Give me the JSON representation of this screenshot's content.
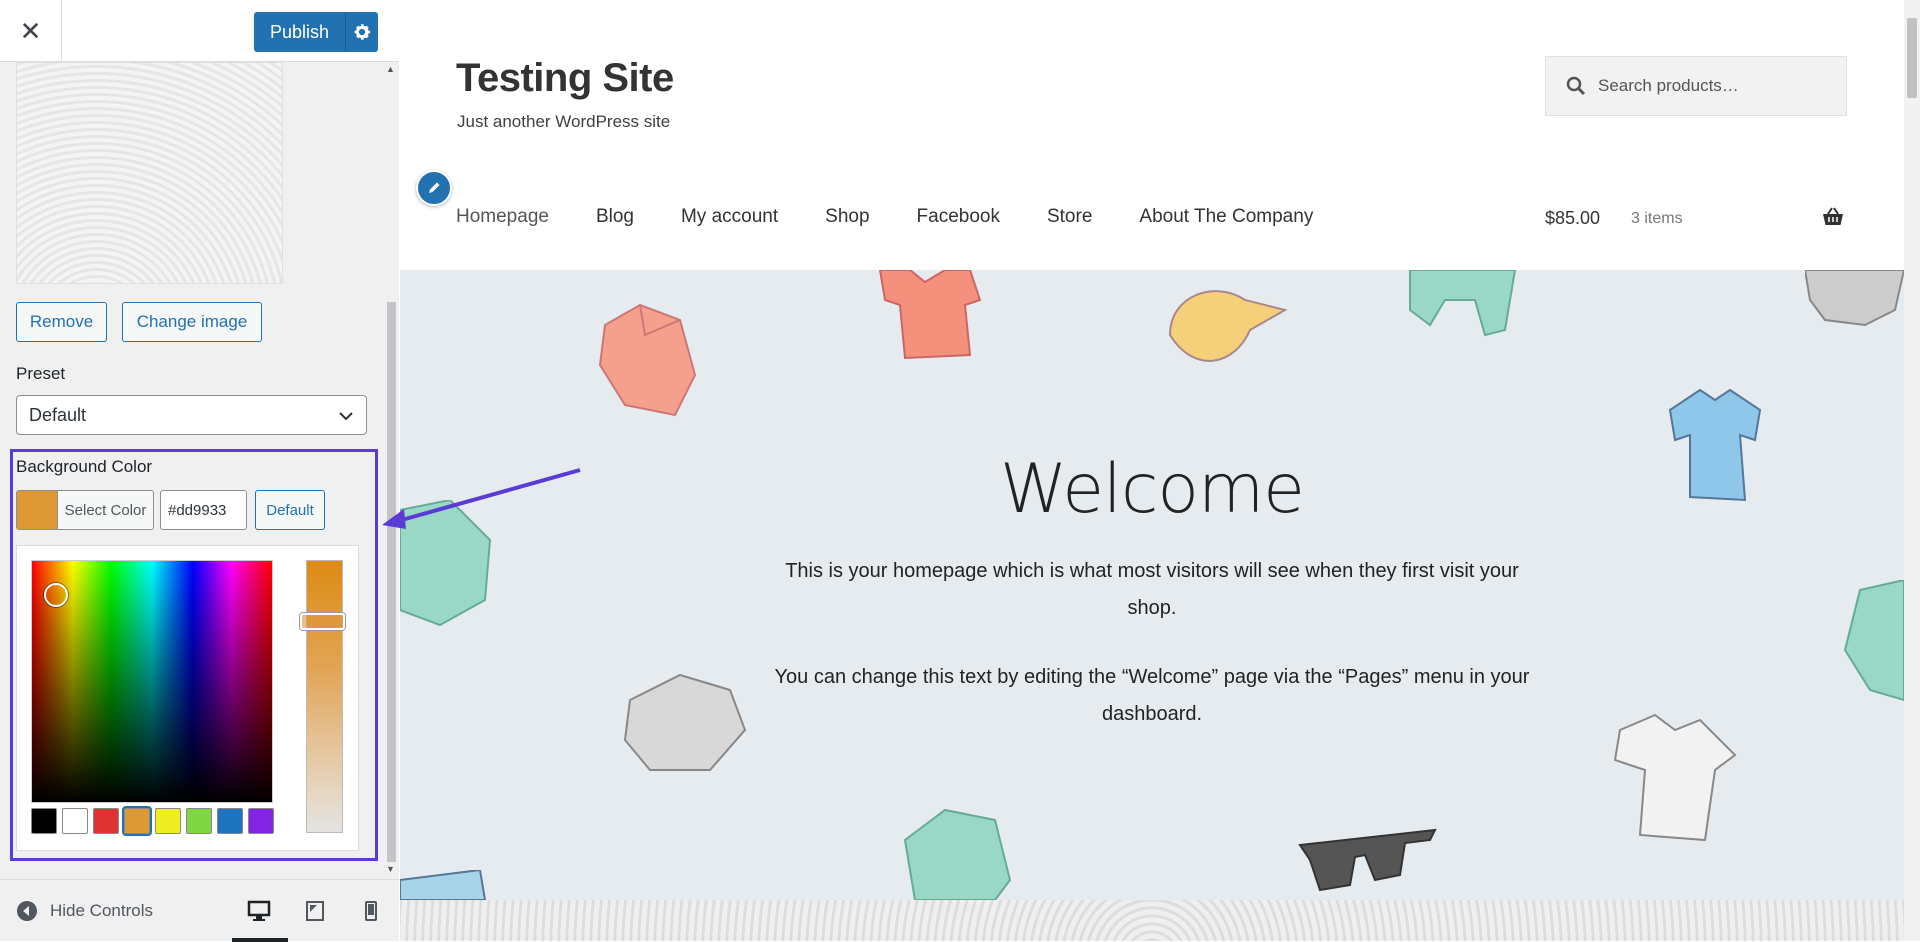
{
  "customizer": {
    "publish_label": "Publish",
    "remove_label": "Remove",
    "change_image_label": "Change image",
    "preset_label": "Preset",
    "preset_value": "Default",
    "bg_color_label": "Background Color",
    "select_color_label": "Select Color",
    "hex_value": "#dd9933",
    "default_label": "Default",
    "current_color": "#dd9933",
    "palette": [
      "#000000",
      "#ffffff",
      "#dd3333",
      "#dd9933",
      "#eeee22",
      "#81d742",
      "#1e73be",
      "#8224e3"
    ],
    "hide_controls_label": "Hide Controls"
  },
  "site": {
    "title": "Testing Site",
    "tagline": "Just another WordPress site",
    "search_placeholder": "Search products…",
    "nav": [
      "Homepage",
      "Blog",
      "My account",
      "Shop",
      "Facebook",
      "Store",
      "About The Company"
    ],
    "cart_total": "$85.00",
    "cart_items": "3 items",
    "welcome_title": "Welcome",
    "welcome_p1": "This is your homepage which is what most visitors will see when they first visit your shop.",
    "welcome_p2": "You can change this text by editing the “Welcome” page via the “Pages” menu in your dashboard."
  },
  "icons": {
    "close": "close-icon",
    "gear": "gear-icon",
    "chevron": "chevron-down-icon",
    "search": "search-icon",
    "edit": "pencil-icon",
    "basket": "basket-icon",
    "desktop": "desktop-icon",
    "tablet": "tablet-icon",
    "mobile": "mobile-icon"
  },
  "colors": {
    "accent": "#2271b1",
    "highlight": "#5b3ad6"
  }
}
